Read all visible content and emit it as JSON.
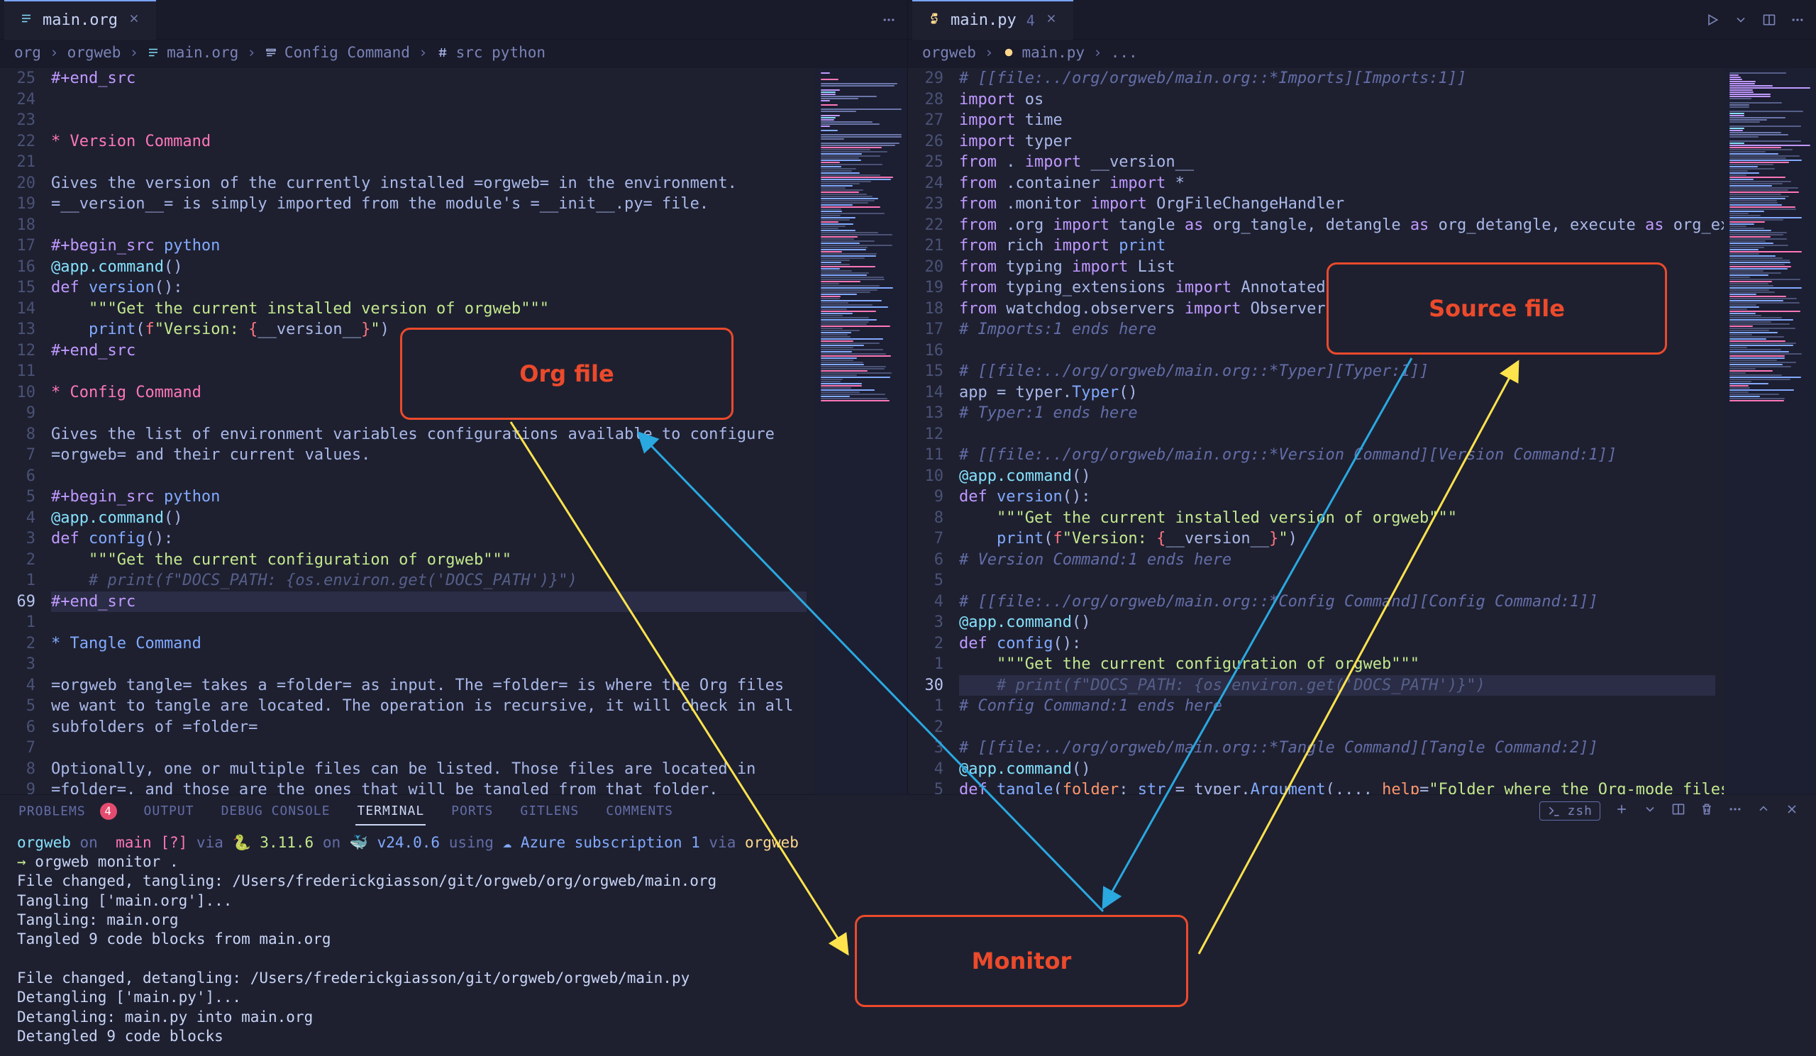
{
  "left": {
    "tab": {
      "filename": "main.org"
    },
    "breadcrumb": [
      "org",
      "orgweb",
      "main.org",
      "Config Command",
      "src python"
    ],
    "lines": [
      {
        "n": "25",
        "t": [
          {
            "cls": "dir",
            "txt": "#+end_src"
          }
        ]
      },
      {
        "n": "24",
        "t": []
      },
      {
        "n": "23",
        "t": []
      },
      {
        "n": "22",
        "t": [
          {
            "cls": "hd1",
            "txt": "* Version Command"
          }
        ]
      },
      {
        "n": "21",
        "t": []
      },
      {
        "n": "20",
        "t": [
          {
            "cls": "i",
            "txt": "Gives the version of the currently installed =orgweb= in the environment."
          }
        ]
      },
      {
        "n": "19",
        "t": [
          {
            "cls": "i",
            "txt": "=__version__= is simply imported from the module's =__init__.py= file."
          }
        ]
      },
      {
        "n": "18",
        "t": []
      },
      {
        "n": "17",
        "t": [
          {
            "cls": "dir",
            "txt": "#+begin_src "
          },
          {
            "cls": "lang",
            "txt": "python"
          }
        ]
      },
      {
        "n": "16",
        "t": [
          {
            "cls": "d",
            "txt": "@app.command"
          },
          {
            "cls": "i",
            "txt": "()"
          }
        ]
      },
      {
        "n": "15",
        "t": [
          {
            "cls": "k",
            "txt": "def "
          },
          {
            "cls": "f",
            "txt": "version"
          },
          {
            "cls": "i",
            "txt": "():"
          }
        ]
      },
      {
        "n": "14",
        "t": [
          {
            "cls": "i",
            "txt": "    "
          },
          {
            "cls": "s",
            "txt": "\"\"\"Get the current installed version of orgweb\"\"\""
          }
        ]
      },
      {
        "n": "13",
        "t": [
          {
            "cls": "i",
            "txt": "    "
          },
          {
            "cls": "f",
            "txt": "print"
          },
          {
            "cls": "i",
            "txt": "("
          },
          {
            "cls": "p",
            "txt": "f"
          },
          {
            "cls": "s",
            "txt": "\"Version: "
          },
          {
            "cls": "p",
            "txt": "{"
          },
          {
            "cls": "i",
            "txt": "__version__"
          },
          {
            "cls": "p",
            "txt": "}"
          },
          {
            "cls": "s",
            "txt": "\""
          },
          {
            "cls": "i",
            "txt": ")"
          }
        ]
      },
      {
        "n": "12",
        "t": [
          {
            "cls": "dir",
            "txt": "#+end_src"
          }
        ]
      },
      {
        "n": "11",
        "t": []
      },
      {
        "n": "10",
        "t": [
          {
            "cls": "hd1",
            "txt": "* Config Command"
          }
        ]
      },
      {
        "n": "9",
        "t": []
      },
      {
        "n": "8",
        "t": [
          {
            "cls": "i",
            "txt": "Gives the list of environment variables configurations available to configure"
          }
        ]
      },
      {
        "n": "7",
        "t": [
          {
            "cls": "i",
            "txt": "=orgweb= and their current values."
          }
        ]
      },
      {
        "n": "6",
        "t": []
      },
      {
        "n": "5",
        "t": [
          {
            "cls": "dir",
            "txt": "#+begin_src "
          },
          {
            "cls": "lang",
            "txt": "python"
          }
        ]
      },
      {
        "n": "4",
        "t": [
          {
            "cls": "d",
            "txt": "@app.command"
          },
          {
            "cls": "i",
            "txt": "()"
          }
        ]
      },
      {
        "n": "3",
        "t": [
          {
            "cls": "k",
            "txt": "def "
          },
          {
            "cls": "f",
            "txt": "config"
          },
          {
            "cls": "i",
            "txt": "():"
          }
        ]
      },
      {
        "n": "2",
        "t": [
          {
            "cls": "i",
            "txt": "    "
          },
          {
            "cls": "s",
            "txt": "\"\"\"Get the current configuration of orgweb\"\"\""
          }
        ]
      },
      {
        "n": "1",
        "t": [
          {
            "cls": "i",
            "txt": "    "
          },
          {
            "cls": "cm",
            "txt": "# print(f\"DOCS_PATH: {os.environ.get('DOCS_PATH')}\")"
          }
        ]
      },
      {
        "n": "69",
        "cur": true,
        "hl": true,
        "t": [
          {
            "cls": "dir",
            "txt": "#+end_src"
          }
        ]
      },
      {
        "n": "1",
        "t": []
      },
      {
        "n": "2",
        "t": [
          {
            "cls": "hd2",
            "txt": "* Tangle Command"
          }
        ]
      },
      {
        "n": "3",
        "t": []
      },
      {
        "n": "4",
        "t": [
          {
            "cls": "i",
            "txt": "=orgweb tangle= takes a =folder= as input. The =folder= is where the Org files"
          }
        ]
      },
      {
        "n": "5",
        "t": [
          {
            "cls": "i",
            "txt": "we want to tangle are located. The operation is recursive, it will check in all"
          }
        ]
      },
      {
        "n": "6",
        "t": [
          {
            "cls": "i",
            "txt": "subfolders of =folder="
          }
        ]
      },
      {
        "n": "7",
        "t": []
      },
      {
        "n": "8",
        "t": [
          {
            "cls": "i",
            "txt": "Optionally, one or multiple files can be listed. Those files are located in"
          }
        ]
      },
      {
        "n": "9",
        "t": [
          {
            "cls": "i",
            "txt": "=folder=, and those are the ones that will be tangled from that folder."
          }
        ]
      }
    ]
  },
  "right": {
    "tab": {
      "filename": "main.py",
      "dirty": "4"
    },
    "breadcrumb": [
      "orgweb",
      "main.py",
      "..."
    ],
    "lines": [
      {
        "n": "29",
        "t": [
          {
            "cls": "c",
            "txt": "# [[file:../org/orgweb/main.org::*Imports][Imports:1]]"
          }
        ]
      },
      {
        "n": "28",
        "t": [
          {
            "cls": "k",
            "txt": "import "
          },
          {
            "cls": "i",
            "txt": "os"
          }
        ]
      },
      {
        "n": "27",
        "t": [
          {
            "cls": "k",
            "txt": "import "
          },
          {
            "cls": "i",
            "txt": "time"
          }
        ]
      },
      {
        "n": "26",
        "t": [
          {
            "cls": "k",
            "txt": "import "
          },
          {
            "cls": "i",
            "txt": "typer"
          }
        ]
      },
      {
        "n": "25",
        "t": [
          {
            "cls": "k",
            "txt": "from "
          },
          {
            "cls": "i",
            "txt": ". "
          },
          {
            "cls": "k",
            "txt": "import "
          },
          {
            "cls": "i",
            "txt": "__version__"
          }
        ]
      },
      {
        "n": "24",
        "t": [
          {
            "cls": "k",
            "txt": "from "
          },
          {
            "cls": "i",
            "txt": ".container "
          },
          {
            "cls": "k",
            "txt": "import "
          },
          {
            "cls": "i",
            "txt": "*"
          }
        ]
      },
      {
        "n": "23",
        "t": [
          {
            "cls": "k",
            "txt": "from "
          },
          {
            "cls": "i",
            "txt": ".monitor "
          },
          {
            "cls": "k",
            "txt": "import "
          },
          {
            "cls": "i",
            "txt": "OrgFileChangeHandler"
          }
        ]
      },
      {
        "n": "22",
        "t": [
          {
            "cls": "k",
            "txt": "from "
          },
          {
            "cls": "i",
            "txt": ".org "
          },
          {
            "cls": "k",
            "txt": "import "
          },
          {
            "cls": "i",
            "txt": "tangle "
          },
          {
            "cls": "k",
            "txt": "as "
          },
          {
            "cls": "i",
            "txt": "org_tangle, detangle "
          },
          {
            "cls": "k",
            "txt": "as "
          },
          {
            "cls": "i",
            "txt": "org_detangle, execute "
          },
          {
            "cls": "k",
            "txt": "as "
          },
          {
            "cls": "i",
            "txt": "org_exec"
          }
        ]
      },
      {
        "n": "21",
        "t": [
          {
            "cls": "k",
            "txt": "from "
          },
          {
            "cls": "i",
            "txt": "rich "
          },
          {
            "cls": "k",
            "txt": "import "
          },
          {
            "cls": "f",
            "txt": "print"
          }
        ]
      },
      {
        "n": "20",
        "t": [
          {
            "cls": "k",
            "txt": "from "
          },
          {
            "cls": "i",
            "txt": "typing "
          },
          {
            "cls": "k",
            "txt": "import "
          },
          {
            "cls": "i",
            "txt": "List"
          }
        ]
      },
      {
        "n": "19",
        "t": [
          {
            "cls": "k",
            "txt": "from "
          },
          {
            "cls": "i",
            "txt": "typing_extensions "
          },
          {
            "cls": "k",
            "txt": "import "
          },
          {
            "cls": "i",
            "txt": "Annotated"
          }
        ]
      },
      {
        "n": "18",
        "t": [
          {
            "cls": "k",
            "txt": "from "
          },
          {
            "cls": "i",
            "txt": "watchdog.observers "
          },
          {
            "cls": "k",
            "txt": "import "
          },
          {
            "cls": "i",
            "txt": "Observer"
          }
        ]
      },
      {
        "n": "17",
        "t": [
          {
            "cls": "c",
            "txt": "# Imports:1 ends here"
          }
        ]
      },
      {
        "n": "16",
        "t": []
      },
      {
        "n": "15",
        "t": [
          {
            "cls": "c",
            "txt": "# [[file:../org/orgweb/main.org::*Typer][Typer:1]]"
          }
        ]
      },
      {
        "n": "14",
        "t": [
          {
            "cls": "i",
            "txt": "app = typer."
          },
          {
            "cls": "f",
            "txt": "Typer"
          },
          {
            "cls": "i",
            "txt": "()"
          }
        ]
      },
      {
        "n": "13",
        "t": [
          {
            "cls": "c",
            "txt": "# Typer:1 ends here"
          }
        ]
      },
      {
        "n": "12",
        "t": []
      },
      {
        "n": "11",
        "t": [
          {
            "cls": "c",
            "txt": "# [[file:../org/orgweb/main.org::*Version Command][Version Command:1]]"
          }
        ]
      },
      {
        "n": "10",
        "t": [
          {
            "cls": "d",
            "txt": "@app.command"
          },
          {
            "cls": "i",
            "txt": "()"
          }
        ]
      },
      {
        "n": "9",
        "t": [
          {
            "cls": "k",
            "txt": "def "
          },
          {
            "cls": "f",
            "txt": "version"
          },
          {
            "cls": "i",
            "txt": "():"
          }
        ]
      },
      {
        "n": "8",
        "t": [
          {
            "cls": "i",
            "txt": "    "
          },
          {
            "cls": "s",
            "txt": "\"\"\"Get the current installed version of orgweb\"\"\""
          }
        ]
      },
      {
        "n": "7",
        "t": [
          {
            "cls": "i",
            "txt": "    "
          },
          {
            "cls": "f",
            "txt": "print"
          },
          {
            "cls": "i",
            "txt": "("
          },
          {
            "cls": "p",
            "txt": "f"
          },
          {
            "cls": "s",
            "txt": "\"Version: "
          },
          {
            "cls": "p",
            "txt": "{"
          },
          {
            "cls": "i",
            "txt": "__version__"
          },
          {
            "cls": "p",
            "txt": "}"
          },
          {
            "cls": "s",
            "txt": "\""
          },
          {
            "cls": "i",
            "txt": ")"
          }
        ]
      },
      {
        "n": "6",
        "t": [
          {
            "cls": "c",
            "txt": "# Version Command:1 ends here"
          }
        ]
      },
      {
        "n": "5",
        "t": []
      },
      {
        "n": "4",
        "t": [
          {
            "cls": "c",
            "txt": "# [[file:../org/orgweb/main.org::*Config Command][Config Command:1]]"
          }
        ]
      },
      {
        "n": "3",
        "t": [
          {
            "cls": "d",
            "txt": "@app.command"
          },
          {
            "cls": "i",
            "txt": "()"
          }
        ]
      },
      {
        "n": "2",
        "t": [
          {
            "cls": "k",
            "txt": "def "
          },
          {
            "cls": "f",
            "txt": "config"
          },
          {
            "cls": "i",
            "txt": "():"
          }
        ]
      },
      {
        "n": "1",
        "t": [
          {
            "cls": "i",
            "txt": "    "
          },
          {
            "cls": "s",
            "txt": "\"\"\"Get the current configuration of orgweb\"\"\""
          }
        ]
      },
      {
        "n": "30",
        "cur": true,
        "hl": true,
        "t": [
          {
            "cls": "i",
            "txt": "    "
          },
          {
            "cls": "cm",
            "txt": "# print(f\"DOCS_PATH: {os.environ.get('DOCS_PATH')}\")"
          }
        ]
      },
      {
        "n": "1",
        "t": [
          {
            "cls": "c",
            "txt": "# Config Command:1 ends here"
          }
        ]
      },
      {
        "n": "2",
        "t": []
      },
      {
        "n": "3",
        "t": [
          {
            "cls": "c",
            "txt": "# [[file:../org/orgweb/main.org::*Tangle Command][Tangle Command:2]]"
          }
        ]
      },
      {
        "n": "4",
        "t": [
          {
            "cls": "d",
            "txt": "@app.command"
          },
          {
            "cls": "i",
            "txt": "()"
          }
        ]
      },
      {
        "n": "5",
        "t": [
          {
            "cls": "k",
            "txt": "def "
          },
          {
            "cls": "f",
            "txt": "tangle"
          },
          {
            "cls": "i",
            "txt": "("
          },
          {
            "cls": "n",
            "txt": "folder"
          },
          {
            "cls": "i",
            "txt": ": "
          },
          {
            "cls": "f",
            "txt": "str"
          },
          {
            "cls": "i",
            "txt": " = typer."
          },
          {
            "cls": "f",
            "txt": "Argument"
          },
          {
            "cls": "i",
            "txt": "(..., "
          },
          {
            "cls": "n",
            "txt": "help"
          },
          {
            "cls": "i",
            "txt": "="
          },
          {
            "cls": "s",
            "txt": "\"Folder where the Org-mode files t"
          }
        ]
      }
    ]
  },
  "panel": {
    "tabs": [
      "PROBLEMS",
      "OUTPUT",
      "DEBUG CONSOLE",
      "TERMINAL",
      "PORTS",
      "GITLENS",
      "COMMENTS"
    ],
    "problems_badge": "4",
    "active": "TERMINAL",
    "shell_label": "zsh",
    "prompt_parts": {
      "project": "orgweb",
      "on": "on",
      "branch_icon": "",
      "branch": "main",
      "status": "[?]",
      "via": "via",
      "py_icon": "🐍",
      "py": "3.11.6",
      "on2": "on",
      "docker": "🐳",
      "node": "v24.0.6",
      "using": "using",
      "cloud": "☁ ",
      "azure": "Azure subscription 1",
      "via2": "via",
      "env": "orgweb"
    },
    "cmd": "orgweb monitor .",
    "output": [
      "File changed, tangling: /Users/frederickgiasson/git/orgweb/org/orgweb/main.org",
      "Tangling ['main.org']...",
      "Tangling: main.org",
      "Tangled 9 code blocks from main.org",
      "",
      "File changed, detangling: /Users/frederickgiasson/git/orgweb/orgweb/main.py",
      "Detangling ['main.py']...",
      "Detangling: main.py into main.org",
      "Detangled 9 code blocks"
    ]
  },
  "callouts": {
    "org": "Org file",
    "source": "Source file",
    "monitor": "Monitor"
  }
}
